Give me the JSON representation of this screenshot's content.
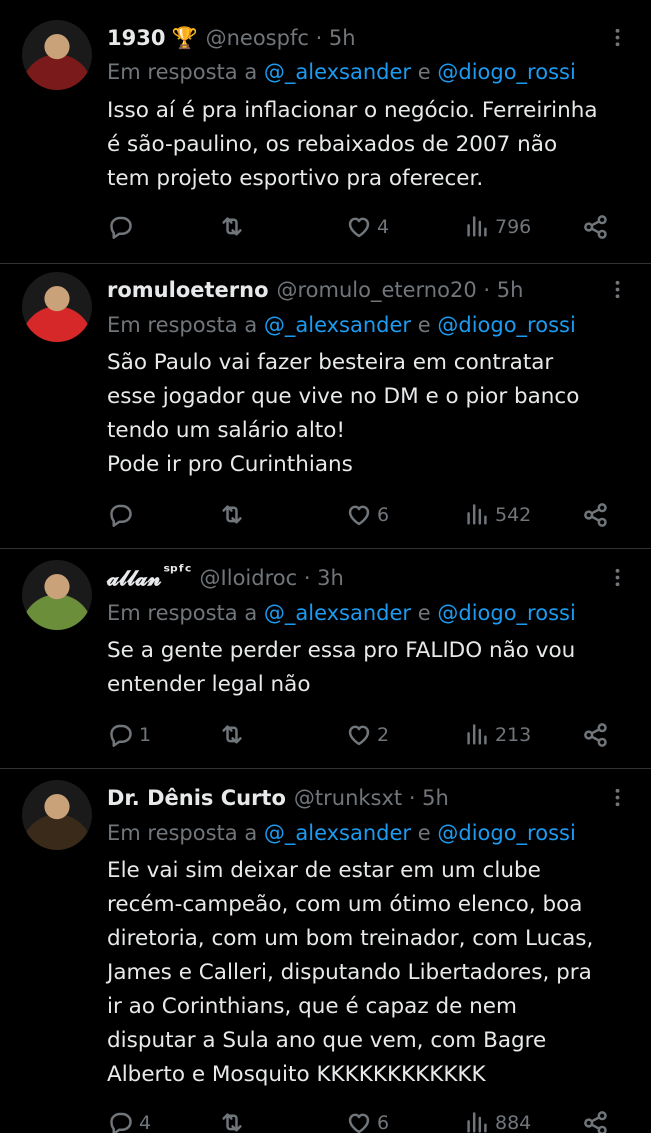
{
  "tweets": [
    {
      "name": "1930",
      "name_extra": "🏆",
      "handle": "@neospfc · 5h",
      "reply_prefix": "Em resposta a",
      "reply_user1": "@_alexsander",
      "reply_and": "e",
      "reply_user2": "@diogo_rossi",
      "lines": [
        "Isso aí é pra inflacionar o negócio. Ferreirinha",
        "é são-paulino, os rebaixados de 2007 não",
        "tem projeto esportivo pra oferecer."
      ],
      "replies": "",
      "retweets": "",
      "likes": "4",
      "views": "796",
      "avatar_color": "#7a1a1a"
    },
    {
      "name": "romuloeterno",
      "name_extra": "",
      "handle": "@romulo_eterno20 · 5h",
      "reply_prefix": "Em resposta a",
      "reply_user1": "@_alexsander",
      "reply_and": "e",
      "reply_user2": "@diogo_rossi",
      "lines": [
        "São Paulo vai fazer besteira em contratar",
        "esse jogador que vive no DM e o pior banco",
        "tendo um salário alto!",
        "Pode ir pro Curinthians"
      ],
      "replies": "",
      "retweets": "",
      "likes": "6",
      "views": "542",
      "avatar_color": "#d62828"
    },
    {
      "name": "𝓪𝓵𝓵𝓪𝓷",
      "name_extra": "ˢᵖᶠᶜ",
      "handle": "@Iloidroc · 3h",
      "reply_prefix": "Em resposta a",
      "reply_user1": "@_alexsander",
      "reply_and": "e",
      "reply_user2": "@diogo_rossi",
      "lines": [
        "Se a gente perder essa pro FALIDO não vou",
        "entender legal não"
      ],
      "replies": "1",
      "retweets": "",
      "likes": "2",
      "views": "213",
      "avatar_color": "#6b8e3a"
    },
    {
      "name": "Dr. Dênis Curto",
      "name_extra": "",
      "handle": "@trunksxt · 5h",
      "reply_prefix": "Em resposta a",
      "reply_user1": "@_alexsander",
      "reply_and": "e",
      "reply_user2": "@diogo_rossi",
      "lines": [
        "Ele vai sim deixar de estar em um clube",
        "recém-campeão, com um ótimo elenco, boa",
        "diretoria, com um bom treinador, com Lucas,",
        "James e Calleri, disputando Libertadores, pra",
        "ir ao Corinthians, que é capaz de nem",
        "disputar a Sula ano que vem, com Bagre",
        "Alberto e Mosquito KKKKKKKKKKKK"
      ],
      "replies": "4",
      "retweets": "",
      "likes": "6",
      "views": "884",
      "avatar_color": "#3a2a1a"
    }
  ],
  "colors": {
    "background": "#000000",
    "text": "#e7e9ea",
    "muted": "#71767b",
    "link": "#1d9bf0",
    "divider": "#2f3336"
  },
  "icons": [
    "reply-icon",
    "retweet-icon",
    "like-icon",
    "views-icon",
    "share-icon",
    "more-icon"
  ]
}
